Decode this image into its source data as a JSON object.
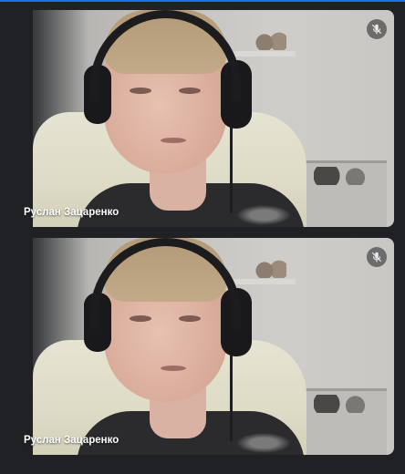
{
  "participants": [
    {
      "name": "Руслан Зацаренко",
      "mic_icon": "mic-off-icon"
    },
    {
      "name": "Руслан Зацаренко",
      "mic_icon": "mic-off-icon"
    }
  ],
  "colors": {
    "background": "#202124",
    "accent": "#1a73e8",
    "name_text": "#ffffff"
  }
}
